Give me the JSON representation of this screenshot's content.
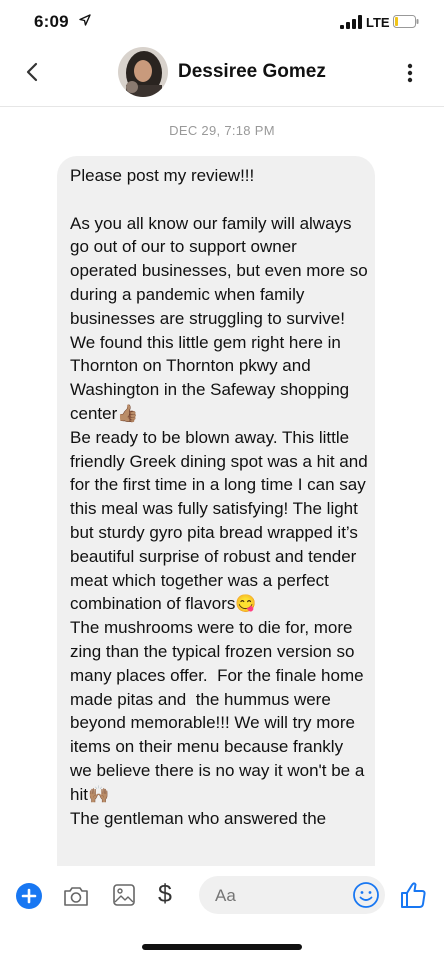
{
  "status_bar": {
    "time": "6:09",
    "network": "LTE"
  },
  "header": {
    "contact_name": "Dessiree Gomez"
  },
  "conversation": {
    "timestamp": "DEC 29, 7:18 PM",
    "message": "Please post my review!!!\n\nAs you all know our family will always go out of our to support owner operated businesses, but even more so during a pandemic when family businesses are struggling to survive! We found this little gem right here in Thornton on Thornton pkwy and Washington in the Safeway shopping center👍🏽\nBe ready to be blown away. This little friendly Greek dining spot was a hit and for the first time in a long time I can say this meal was fully satisfying! The light but sturdy gyro pita bread wrapped it’s beautiful surprise of robust and tender meat which together was a perfect combination of flavors😋\nThe mushrooms were to die for, more zing than the typical frozen version so many places offer.  For the finale home made pitas and  the hummus were beyond memorable!!! We will try more items on their menu because frankly we believe there is no way it won't be a hit🙌🏽\nThe gentleman who answered the"
  },
  "composer": {
    "placeholder": "Aa",
    "dollar_label": "$"
  },
  "colors": {
    "accent": "#1877f2",
    "bubble": "#f0f0f0",
    "timestamp": "#999999"
  }
}
